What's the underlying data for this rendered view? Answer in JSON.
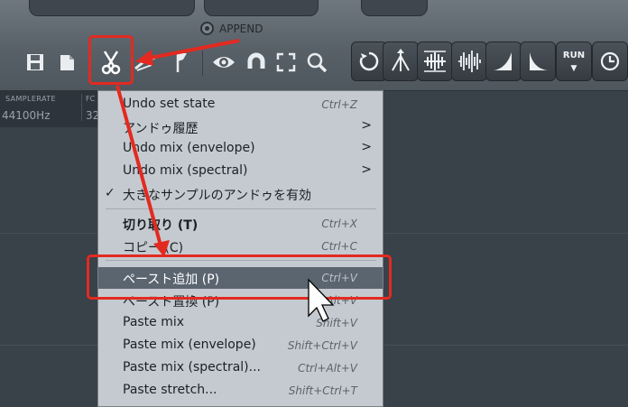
{
  "toolbar": {
    "append_label": "APPEND",
    "icons_left": [
      "save-icon",
      "copy-icon",
      "scissors-icon",
      "paste-icon",
      "flag-icon",
      "eye-icon",
      "magnet-icon",
      "select-frame-icon",
      "zoom-icon"
    ],
    "tools": [
      "loop-icon",
      "warp-icon",
      "waveform-icon",
      "noise-icon",
      "fade-in-icon",
      "fade-out-icon"
    ],
    "run_label": "RUN"
  },
  "info": {
    "samplerate_label": "SAMPLERATE",
    "samplerate_value": "44100Hz",
    "second_label": "FC",
    "second_value": "32"
  },
  "menu": {
    "items": [
      {
        "label": "Undo set state",
        "shortcut": "Ctrl+Z"
      },
      {
        "label": "アンドゥ履歴",
        "submenu": ">"
      },
      {
        "label": "Undo mix (envelope)",
        "submenu": ">"
      },
      {
        "label": "Undo mix (spectral)",
        "submenu": ">"
      },
      {
        "label": "大きなサンプルのアンドゥを有効",
        "check": "✓"
      },
      {
        "label": "切り取り (T)",
        "shortcut": "Ctrl+X"
      },
      {
        "label": "コピー (C)",
        "shortcut": "Ctrl+C"
      },
      {
        "label": "ペースト追加 (P)",
        "shortcut": "Ctrl+V"
      },
      {
        "label": "ペースト置換 (P)",
        "shortcut": "Alt+V"
      },
      {
        "label": "Paste mix",
        "shortcut": "Shift+V"
      },
      {
        "label": "Paste mix (envelope)",
        "shortcut": "Shift+Ctrl+V"
      },
      {
        "label": "Paste mix (spectral)...",
        "shortcut": "Ctrl+Alt+V"
      },
      {
        "label": "Paste stretch...",
        "shortcut": "Shift+Ctrl+T"
      }
    ]
  },
  "colors": {
    "highlight": "#e32a20",
    "menu_bg": "#c5cad0",
    "menu_highlight": "#5b6570"
  }
}
